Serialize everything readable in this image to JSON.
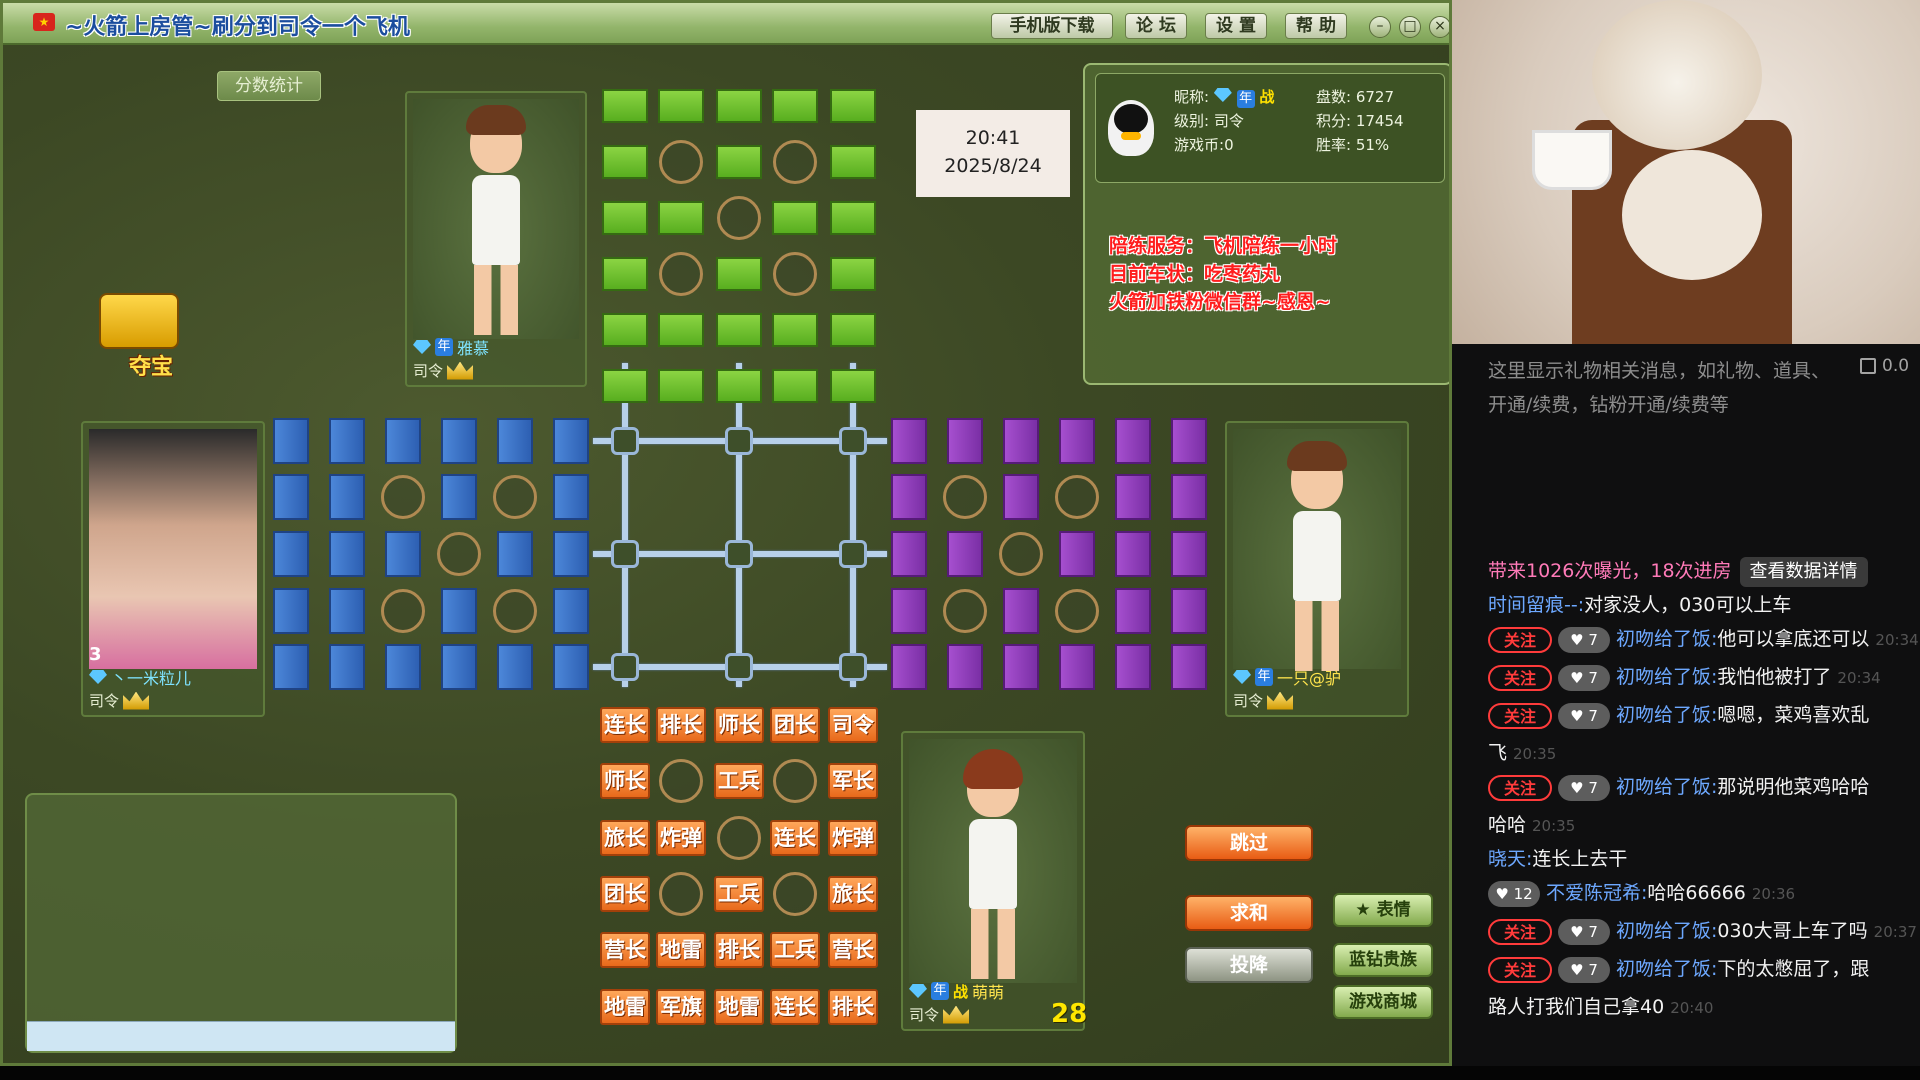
{
  "window": {
    "title": "~火箭上房管~刷分到司令一个飞机",
    "menu": [
      "手机版下载",
      "论 坛",
      "设 置",
      "帮 助"
    ],
    "controls": [
      "–",
      "□",
      "×"
    ]
  },
  "score_tab": "分数统计",
  "clock": {
    "time": "20:41",
    "date": "2025/8/24"
  },
  "treasure": {
    "label": "夺宝"
  },
  "profile": {
    "nickname_label": "昵称:",
    "level_label": "级别:",
    "level_value": "司令",
    "coins_label": "游戏币:",
    "coins_value": "0",
    "games_label": "盘数:",
    "games_value": "6727",
    "points_label": "积分:",
    "points_value": "17454",
    "winrate_label": "胜率:",
    "winrate_value": "51%",
    "war_badge": "战"
  },
  "promo": [
    "陪练服务：飞机陪练一小时",
    "目前车状：吃枣药丸",
    "火箭加铁粉微信群~感恩~"
  ],
  "players": {
    "top": {
      "name": "雅慕",
      "rank": "司令"
    },
    "left": {
      "name": "丶一米粒儿",
      "rank": "司令",
      "level_badge": "3"
    },
    "right": {
      "name": "一只@驴",
      "rank": "司令"
    },
    "bottom": {
      "name": "萌萌",
      "rank": "司令",
      "war_badge": "战"
    }
  },
  "year_badge": "年",
  "own_pieces": [
    [
      "连长",
      "排长",
      "师长",
      "团长",
      "司令"
    ],
    [
      "师长",
      "",
      "工兵",
      "",
      "军长"
    ],
    [
      "旅长",
      "炸弹",
      "",
      "连长",
      "炸弹"
    ],
    [
      "团长",
      "",
      "工兵",
      "",
      "旅长"
    ],
    [
      "营长",
      "地雷",
      "排长",
      "工兵",
      "营长"
    ],
    [
      "地雷",
      "军旗",
      "地雷",
      "连长",
      "排长"
    ]
  ],
  "actions": {
    "skip": "跳过",
    "draw": "求和",
    "surrender": "投降",
    "emote": "表情",
    "vip": "蓝钻贵族",
    "shop": "游戏商城"
  },
  "timer": "28",
  "stream": {
    "gift_notice": "这里显示礼物相关消息，如礼物、道具、开通/续费，钻粉开通/续费等",
    "gift_count": "0.0",
    "follow_label": "关注",
    "chat": [
      {
        "segments": [
          "带来1026次曝光，18次进房"
        ],
        "button": "查看数据详情",
        "style": "system"
      },
      {
        "name": "时间留痕--:",
        "text": "对家没人，030可以上车"
      },
      {
        "follow": true,
        "level": "7",
        "name": "初吻给了饭:",
        "text": "他可以拿底还可以",
        "time": "20:34"
      },
      {
        "follow": true,
        "level": "7",
        "name": "初吻给了饭:",
        "text": "我怕他被打了",
        "time": "20:34"
      },
      {
        "follow": true,
        "level": "7",
        "name": "初吻给了饭:",
        "text": "嗯嗯，菜鸡喜欢乱",
        "cont": "飞",
        "time": "20:35"
      },
      {
        "follow": true,
        "level": "7",
        "name": "初吻给了饭:",
        "text": "那说明他菜鸡哈哈",
        "cont": "哈哈",
        "time": "20:35"
      },
      {
        "name": "晓天:",
        "text": "连长上去干"
      },
      {
        "level": "12",
        "name": "不爱陈冠希:",
        "text": "哈哈66666",
        "time": "20:36"
      },
      {
        "follow": true,
        "level": "7",
        "name": "初吻给了饭:",
        "text": "030大哥上车了吗",
        "time": "20:37"
      },
      {
        "follow": true,
        "level": "7",
        "name": "初吻给了饭:",
        "text": "下的太憋屈了，跟",
        "cont": "路人打我们自己拿40",
        "time": "20:40"
      }
    ]
  }
}
